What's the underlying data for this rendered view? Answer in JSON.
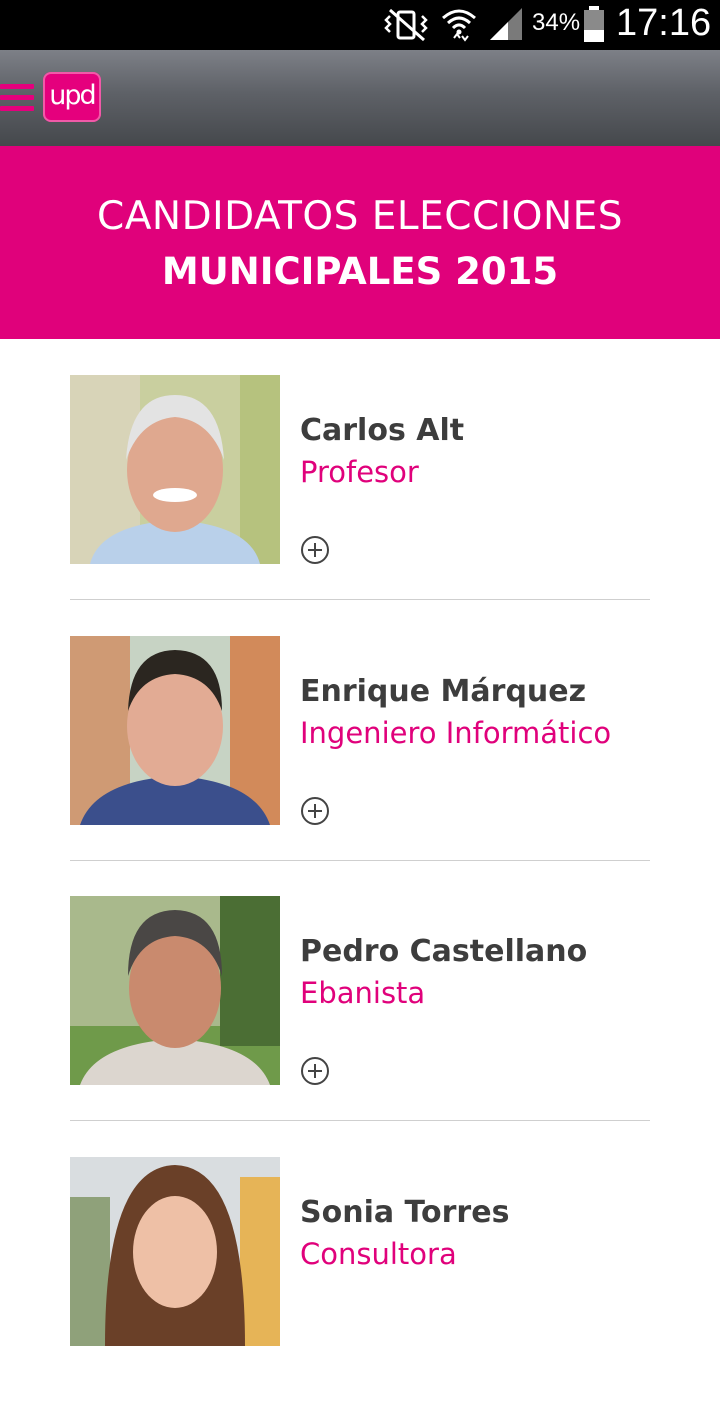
{
  "status_bar": {
    "battery_percent": "34%",
    "time": "17:16",
    "icons": [
      "mute-vibrate-icon",
      "wifi-icon",
      "signal-icon",
      "battery-icon"
    ]
  },
  "app_bar": {
    "logo_text": "upd",
    "menu_icon": "hamburger-menu-icon"
  },
  "banner": {
    "line1": "CANDIDATOS ELECCIONES",
    "line2": "MUNICIPALES 2015"
  },
  "candidates": [
    {
      "name": "Carlos Alt",
      "profession": "Profesor"
    },
    {
      "name": "Enrique Márquez",
      "profession": "Ingeniero Informático"
    },
    {
      "name": "Pedro Castellano",
      "profession": "Ebanista"
    },
    {
      "name": "Sonia Torres",
      "profession": "Consultora"
    }
  ],
  "colors": {
    "brand_magenta": "#e0017b",
    "name_text": "#3d3d3d",
    "divider": "#cfcfcf"
  }
}
